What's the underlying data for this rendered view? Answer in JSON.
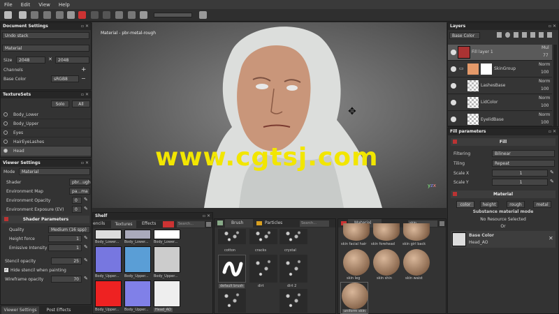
{
  "menu": [
    "File",
    "Edit",
    "View",
    "Help"
  ],
  "document_settings": {
    "title": "Document Settings",
    "undo_stack": "Undo stack",
    "material": "Material",
    "size_label": "Size",
    "size_w": "2048",
    "size_h": "2048",
    "channels_label": "Channels",
    "base_color_label": "Base Color",
    "base_color_format": "sRGB8"
  },
  "texture_sets": {
    "title": "TextureSets",
    "solo": "Solo",
    "all": "All",
    "items": [
      "Body_Lower",
      "Body_Upper",
      "Eyes",
      "HairEyeLashes",
      "Head"
    ],
    "selected": "Head"
  },
  "viewer_settings": {
    "title": "Viewer Settings",
    "mode_label": "Mode",
    "mode_value": "Material",
    "shader_label": "Shader",
    "shader_value": "pbr...ugh",
    "env_map_label": "Environment Map",
    "env_map_value": "pa...ma",
    "env_opacity_label": "Environment Opacity",
    "env_opacity_value": "0",
    "env_exposure_label": "Environment Exposure (EV)",
    "env_exposure_value": "0",
    "shader_params": "Shader Parameters",
    "quality_label": "Quality",
    "quality_value": "Medium (16 spp)",
    "height_label": "Height force",
    "height_value": "1",
    "emissive_label": "Emissive Intensity",
    "emissive_value": "1",
    "stencil_label": "Stencil opacity",
    "stencil_value": "25",
    "hide_stencil": "Hide stencil when painting",
    "wireframe_label": "Wireframe opacity",
    "wireframe_value": "70",
    "tab_viewer": "Viewer Settings",
    "tab_post": "Post Effects"
  },
  "viewport": {
    "label": "Material - pbr-metal-rough",
    "watermark": "www.cgtsj.com"
  },
  "shelf": {
    "title": "Shelf",
    "tabs": [
      "encils",
      "Textures",
      "Effects"
    ],
    "search_placeholder": "Search...",
    "textures": [
      "Body_Lower...",
      "Body_Lower...",
      "Body_Lower...",
      "Body_Upper...",
      "Body_Upper...",
      "Body_Upper...",
      "Body_Upper...",
      "Body_Upper...",
      "Head_AO"
    ],
    "brush_tab": "Brush",
    "particles_tab": "Particles",
    "brushes": [
      "cotton",
      "cracks",
      "crystal",
      "default brush",
      "dirt",
      "dirt 2"
    ],
    "material_tab": "Material",
    "material_filter": "skin",
    "materials": [
      "skin facial hair",
      "skin forehead",
      "skin girl back",
      "skin leg",
      "skin shin",
      "skin waist",
      "uniform skin"
    ]
  },
  "layers": {
    "title": "Layers",
    "blend_mode": "Base Color",
    "items": [
      {
        "name": "Fill layer 1",
        "blend": "Mul",
        "opacity": "77"
      },
      {
        "name": "SkinGroup",
        "blend": "Norm",
        "opacity": "100"
      },
      {
        "name": "LashesBase",
        "blend": "Norm",
        "opacity": "100"
      },
      {
        "name": "LidColor",
        "blend": "Norm",
        "opacity": "100"
      },
      {
        "name": "EyelidBase",
        "blend": "Norm",
        "opacity": "100"
      }
    ]
  },
  "fill_params": {
    "title": "Fill parameters",
    "fill": "Fill",
    "filtering_label": "Filtering",
    "filtering_value": "Bilinear",
    "tiling_label": "Tiling",
    "tiling_value": "Repeat",
    "scale_x_label": "Scale X",
    "scale_x_value": "1",
    "scale_y_label": "Scale Y",
    "scale_y_value": "1",
    "material": "Material",
    "chan_tabs": [
      "color",
      "height",
      "rough",
      "metal"
    ],
    "substance_mode": "Substance material mode",
    "no_resource": "No Resource Selected",
    "or": "Or",
    "base_color": "Base Color",
    "base_color_map": "Head_AO"
  }
}
